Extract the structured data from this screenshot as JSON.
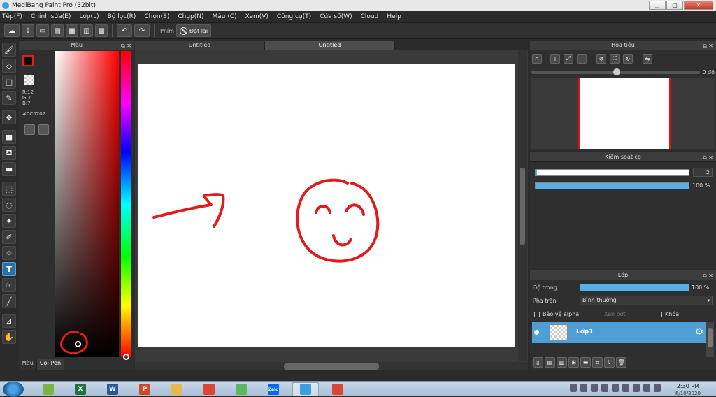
{
  "window": {
    "title": "MediBang Paint Pro (32bit)"
  },
  "menu": [
    "Tệp(F)",
    "Chỉnh sửa(E)",
    "Lớp(L)",
    "Bộ lọc(R)",
    "Chọn(S)",
    "Chụp(N)",
    "Màu (C)",
    "Xem(V)",
    "Công cụ(T)",
    "Cửa sổ(W)",
    "Cloud",
    "Help"
  ],
  "toolbar": {
    "shortcut_label": "Phím",
    "reset_label": "Đặt lại"
  },
  "color_panel": {
    "title": "Màu",
    "r": "R:12",
    "g": "G:7",
    "b": "B:7",
    "hex": "#0C0707",
    "tabs": [
      "Màu",
      "Cọ: Pen"
    ],
    "colors": {
      "foreground": "#0c0707",
      "background": "#ffffff",
      "hue": "#ff0000"
    }
  },
  "document": {
    "tabs": [
      "Untitled",
      "Untitled"
    ],
    "active_tab": 1,
    "stroke_color": "#e21b1b"
  },
  "navigator": {
    "title": "Hoa tiêu",
    "rotation_value": "0 độ"
  },
  "brush_control": {
    "title": "Kiểm soát cọ",
    "size": "2",
    "opacity": "100 %",
    "opacity_fraction": 1.0
  },
  "layers": {
    "title": "Lớp",
    "opacity_label": "Độ trong",
    "opacity_value": "100 %",
    "blend_label": "Pha trộn",
    "blend_value": "Bình thường",
    "protect_alpha": "Bảo vệ alpha",
    "clipping": "Xén bớt",
    "lock": "Khóa",
    "items": [
      {
        "name": "Lớp1"
      }
    ]
  },
  "taskbar": {
    "apps": [
      {
        "icon": "bluestacks-icon",
        "color": "#7cb342",
        "label": ""
      },
      {
        "icon": "excel-icon",
        "color": "#1e7145",
        "label": "X"
      },
      {
        "icon": "word-icon",
        "color": "#2b579a",
        "label": "W"
      },
      {
        "icon": "powerpoint-icon",
        "color": "#d24726",
        "label": "P"
      },
      {
        "icon": "file-explorer-icon",
        "color": "#e8b84a",
        "label": ""
      },
      {
        "icon": "chrome-icon",
        "color": "#db4437",
        "label": ""
      },
      {
        "icon": "coccoc-icon",
        "color": "#5cb85c",
        "label": ""
      },
      {
        "icon": "zalo-icon",
        "color": "#0068ff",
        "label": "Zalo"
      },
      {
        "icon": "medibang-icon",
        "color": "#3aa0e0",
        "label": ""
      },
      {
        "icon": "chrome-icon",
        "color": "#db4437",
        "label": ""
      }
    ],
    "active_index": 8,
    "time": "2:30 PM",
    "date": "6/10/2020"
  }
}
